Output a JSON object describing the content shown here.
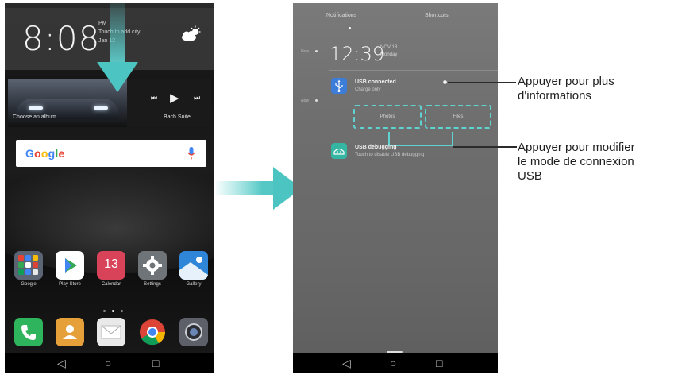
{
  "home": {
    "clock": "8:08",
    "am_pm": "PM",
    "weather_hint": "Touch to add city",
    "date": "Jan 12",
    "music": {
      "album_label": "Choose an album",
      "track_label": "Bach Suite"
    },
    "search_brand": [
      "G",
      "o",
      "o",
      "g",
      "l",
      "e"
    ],
    "apps": [
      {
        "label": "Google",
        "icon": "google-folder-icon"
      },
      {
        "label": "Play Store",
        "icon": "play-store-icon"
      },
      {
        "label": "Calendar",
        "icon": "calendar-icon",
        "badge": "13"
      },
      {
        "label": "Settings",
        "icon": "gear-icon"
      },
      {
        "label": "Gallery",
        "icon": "gallery-icon"
      }
    ],
    "dock": [
      {
        "icon": "phone-icon"
      },
      {
        "icon": "contacts-icon"
      },
      {
        "icon": "mail-icon"
      },
      {
        "icon": "chrome-icon"
      },
      {
        "icon": "camera-icon"
      }
    ]
  },
  "panel": {
    "tabs": [
      "Notifications",
      "Shortcuts"
    ],
    "time": "12:39",
    "date_line1": "NOV 18",
    "date_line2": "Monday",
    "side_times": [
      "Now",
      "Now"
    ],
    "notifications": [
      {
        "title": "USB connected",
        "subtitle": "Charge only",
        "actions": [
          "Photos",
          "Files"
        ]
      },
      {
        "title": "USB debugging",
        "subtitle": "Touch to disable USB debugging"
      }
    ]
  },
  "callouts": {
    "more_info": [
      "Appuyer pour plus",
      "d'informations"
    ],
    "usb_mode": [
      "Appuyer pour modifier",
      "le mode de connexion",
      "USB"
    ]
  },
  "colors": {
    "accent_cyan": "#5fd3d0",
    "usb_icon_bg": "#3b7dd8",
    "debug_icon_bg": "#35b6a3"
  }
}
